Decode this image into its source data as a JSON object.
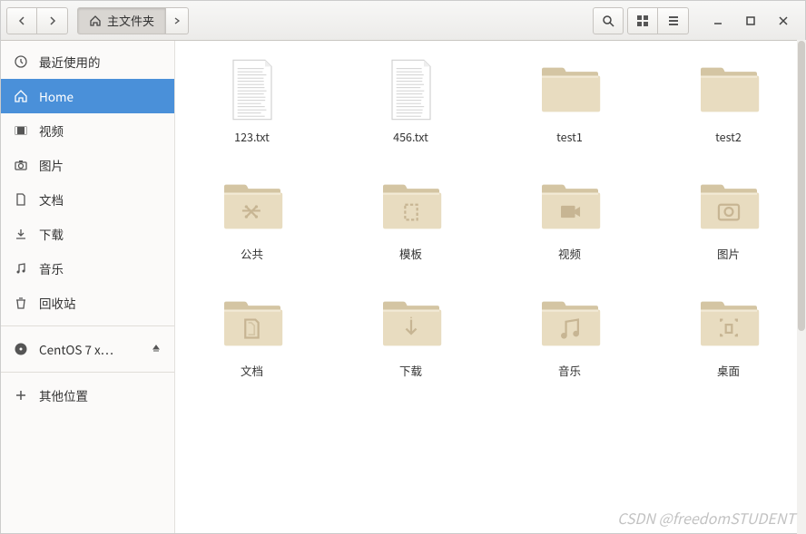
{
  "path": {
    "current": "主文件夹"
  },
  "sidebar": {
    "items": [
      {
        "label": "最近使用的",
        "icon": "clock"
      },
      {
        "label": "Home",
        "icon": "home",
        "active": true
      },
      {
        "label": "视频",
        "icon": "video"
      },
      {
        "label": "图片",
        "icon": "camera"
      },
      {
        "label": "文档",
        "icon": "document"
      },
      {
        "label": "下载",
        "icon": "download"
      },
      {
        "label": "音乐",
        "icon": "music"
      },
      {
        "label": "回收站",
        "icon": "trash"
      }
    ],
    "device": {
      "label": "CentOS 7 x…"
    },
    "other": {
      "label": "其他位置"
    }
  },
  "files": [
    {
      "name": "123.txt",
      "type": "text"
    },
    {
      "name": "456.txt",
      "type": "text"
    },
    {
      "name": "test1",
      "type": "folder"
    },
    {
      "name": "test2",
      "type": "folder"
    },
    {
      "name": "公共",
      "type": "folder-share"
    },
    {
      "name": "模板",
      "type": "folder-template"
    },
    {
      "name": "视频",
      "type": "folder-video"
    },
    {
      "name": "图片",
      "type": "folder-picture"
    },
    {
      "name": "文档",
      "type": "folder-document"
    },
    {
      "name": "下载",
      "type": "folder-download"
    },
    {
      "name": "音乐",
      "type": "folder-music"
    },
    {
      "name": "桌面",
      "type": "folder-desktop"
    }
  ],
  "watermark": "CSDN @freedomSTUDENT"
}
